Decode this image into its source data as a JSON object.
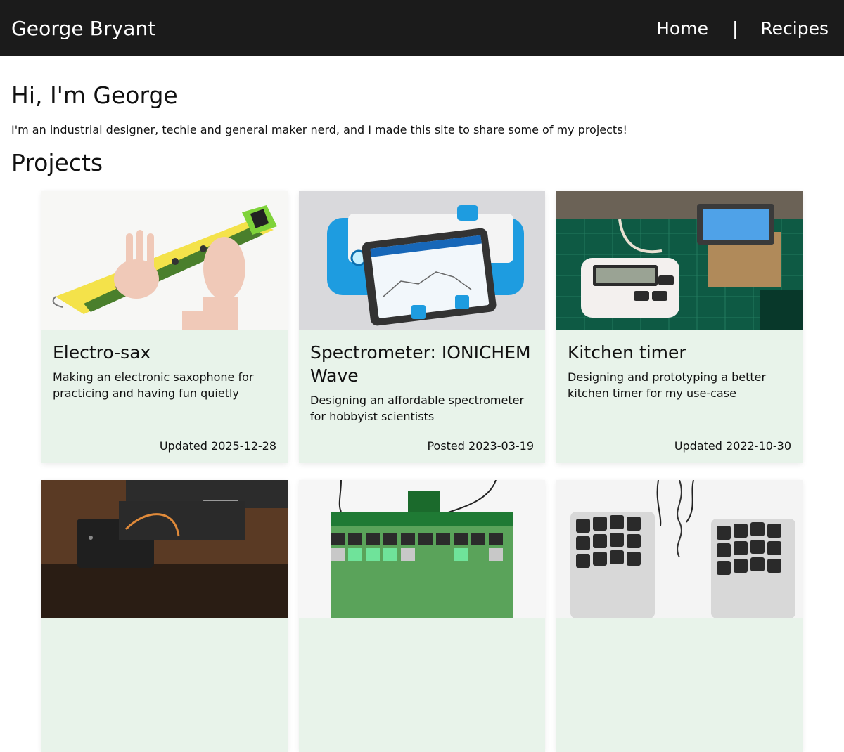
{
  "header": {
    "site_title": "George Bryant",
    "nav": {
      "home": "Home",
      "separator": "|",
      "recipes": "Recipes"
    }
  },
  "intro": {
    "heading": "Hi, I'm George",
    "text": "I'm an industrial designer, techie and general maker nerd, and I made this site to share some of my projects!"
  },
  "projects": {
    "heading": "Projects",
    "cards": [
      {
        "title": "Electro-sax",
        "description": "Making an electronic saxophone for practicing and having fun quietly",
        "date": "Updated 2025-12-28",
        "image": "electro-sax-photo"
      },
      {
        "title": "Spectrometer: IONICHEM Wave",
        "description": "Designing an affordable spectrometer for hobbyist scientists",
        "date": "Posted 2023-03-19",
        "image": "spectrometer-photo"
      },
      {
        "title": "Kitchen timer",
        "description": "Designing and prototyping a better kitchen timer for my use-case",
        "date": "Updated 2022-10-30",
        "image": "kitchen-timer-photo"
      },
      {
        "title": "",
        "description": "",
        "date": "",
        "image": "monitor-mount-photo"
      },
      {
        "title": "",
        "description": "",
        "date": "",
        "image": "green-keyboard-photo"
      },
      {
        "title": "",
        "description": "",
        "date": "",
        "image": "split-keyboard-photo"
      }
    ]
  },
  "colors": {
    "header_bg": "#1b1b1b",
    "card_bg": "#e8f3ea"
  }
}
